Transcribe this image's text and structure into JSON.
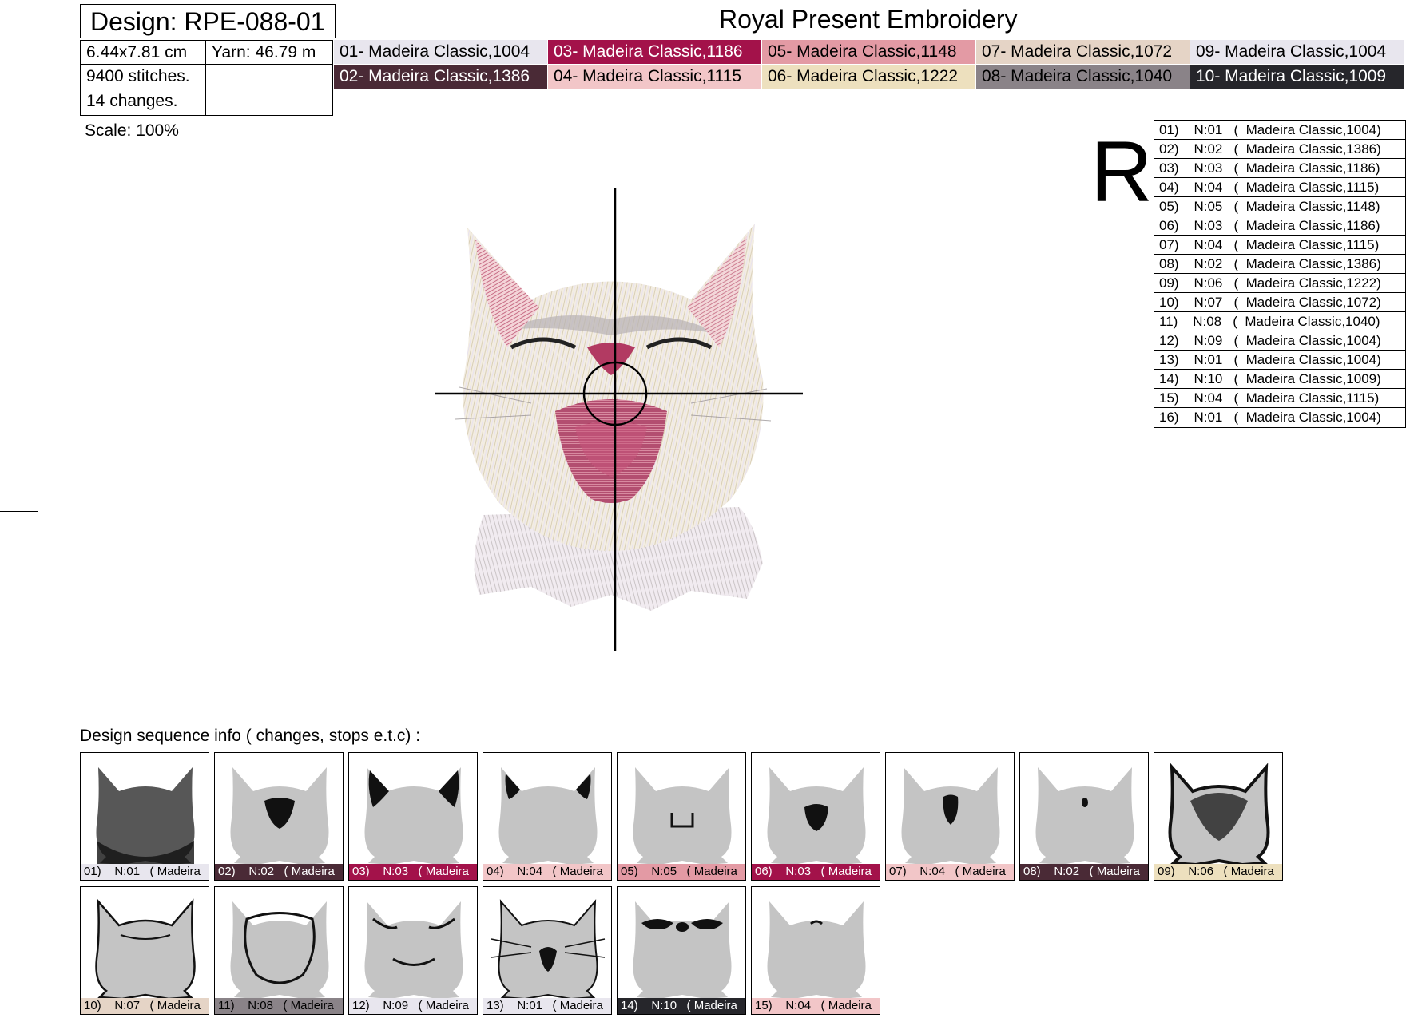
{
  "header": {
    "design_title": "Design: RPE-088-01",
    "company": "Royal Present Embroidery"
  },
  "design_info": {
    "size": "6.44x7.81 cm",
    "yarn": "Yarn: 46.79 m",
    "stitches": "9400 stitches.",
    "changes": "14 changes.",
    "scale": "Scale: 100%"
  },
  "threads": [
    {
      "label": "01- Madeira Classic,1004",
      "color": "#e8e6ee",
      "text_color": "#000000"
    },
    {
      "label": "02- Madeira Classic,1386",
      "color": "#4a2a36",
      "text_color": "#ffffff"
    },
    {
      "label": "03- Madeira Classic,1186",
      "color": "#a3124a",
      "text_color": "#ffffff"
    },
    {
      "label": "04- Madeira Classic,1115",
      "color": "#f2c6c8",
      "text_color": "#000000"
    },
    {
      "label": "05- Madeira Classic,1148",
      "color": "#e39aa4",
      "text_color": "#000000"
    },
    {
      "label": "06- Madeira Classic,1222",
      "color": "#ede0be",
      "text_color": "#000000"
    },
    {
      "label": "07- Madeira Classic,1072",
      "color": "#e5d4c6",
      "text_color": "#000000"
    },
    {
      "label": "08- Madeira Classic,1040",
      "color": "#8a8388",
      "text_color": "#000000"
    },
    {
      "label": "09- Madeira Classic,1004",
      "color": "#e8e6ee",
      "text_color": "#000000"
    },
    {
      "label": "10- Madeira Classic,1009",
      "color": "#26262b",
      "text_color": "#ffffff"
    }
  ],
  "big_letter": "R",
  "sequence": [
    "01)    N:01   (  Madeira Classic,1004)",
    "02)    N:02   (  Madeira Classic,1386)",
    "03)    N:03   (  Madeira Classic,1186)",
    "04)    N:04   (  Madeira Classic,1115)",
    "05)    N:05   (  Madeira Classic,1148)",
    "06)    N:03   (  Madeira Classic,1186)",
    "07)    N:04   (  Madeira Classic,1115)",
    "08)    N:02   (  Madeira Classic,1386)",
    "09)    N:06   (  Madeira Classic,1222)",
    "10)    N:07   (  Madeira Classic,1072)",
    "11)    N:08   (  Madeira Classic,1040)",
    "12)    N:09   (  Madeira Classic,1004)",
    "13)    N:01   (  Madeira Classic,1004)",
    "14)    N:10   (  Madeira Classic,1009)",
    "15)    N:04   (  Madeira Classic,1115)",
    "16)    N:01   (  Madeira Classic,1004)"
  ],
  "sequence_heading": "Design sequence info   ( changes, stops e.t.c)   :",
  "thumbnails": [
    {
      "label": "01)    N:01   ( Madeira",
      "color": "#e8e6ee",
      "text_color": "#000000",
      "part": "full-dark"
    },
    {
      "label": "02)    N:02   ( Madeira",
      "color": "#4a2a36",
      "text_color": "#ffffff",
      "part": "mouth"
    },
    {
      "label": "03)    N:03   ( Madeira",
      "color": "#a3124a",
      "text_color": "#ffffff",
      "part": "ears"
    },
    {
      "label": "04)    N:04   ( Madeira",
      "color": "#f2c6c8",
      "text_color": "#000000",
      "part": "ears-small"
    },
    {
      "label": "05)    N:05   ( Madeira",
      "color": "#e39aa4",
      "text_color": "#000000",
      "part": "tongue"
    },
    {
      "label": "06)    N:03   ( Madeira",
      "color": "#a3124a",
      "text_color": "#ffffff",
      "part": "mouth-fill"
    },
    {
      "label": "07)    N:04   ( Madeira",
      "color": "#f2c6c8",
      "text_color": "#000000",
      "part": "nose-strip"
    },
    {
      "label": "08)    N:02   ( Madeira",
      "color": "#4a2a36",
      "text_color": "#ffffff",
      "part": "dot"
    },
    {
      "label": "09)    N:06   ( Madeira",
      "color": "#ede0be",
      "text_color": "#000000",
      "part": "outline-heavy"
    },
    {
      "label": "10)    N:07   ( Madeira",
      "color": "#e5d4c6",
      "text_color": "#000000",
      "part": "outline-medium"
    },
    {
      "label": "11)    N:08   ( Madeira",
      "color": "#8a8388",
      "text_color": "#000000",
      "part": "outline-light"
    },
    {
      "label": "12)    N:09   ( Madeira",
      "color": "#e8e6ee",
      "text_color": "#000000",
      "part": "patches"
    },
    {
      "label": "13)    N:01   ( Madeira",
      "color": "#e8e6ee",
      "text_color": "#000000",
      "part": "whiskers"
    },
    {
      "label": "14)    N:10   ( Madeira",
      "color": "#26262b",
      "text_color": "#ffffff",
      "part": "eyes"
    },
    {
      "label": "15)    N:04   ( Madeira",
      "color": "#f2c6c8",
      "text_color": "#000000",
      "part": "small-mark"
    }
  ]
}
